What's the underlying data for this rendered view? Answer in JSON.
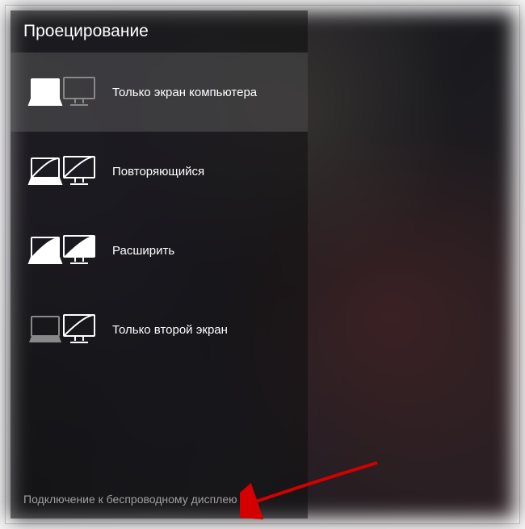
{
  "panel": {
    "title": "Проецирование",
    "options": [
      {
        "label": "Только экран компьютера"
      },
      {
        "label": "Повторяющийся"
      },
      {
        "label": "Расширить"
      },
      {
        "label": "Только второй экран"
      }
    ],
    "footer_link": "Подключение к беспроводному дисплею"
  }
}
